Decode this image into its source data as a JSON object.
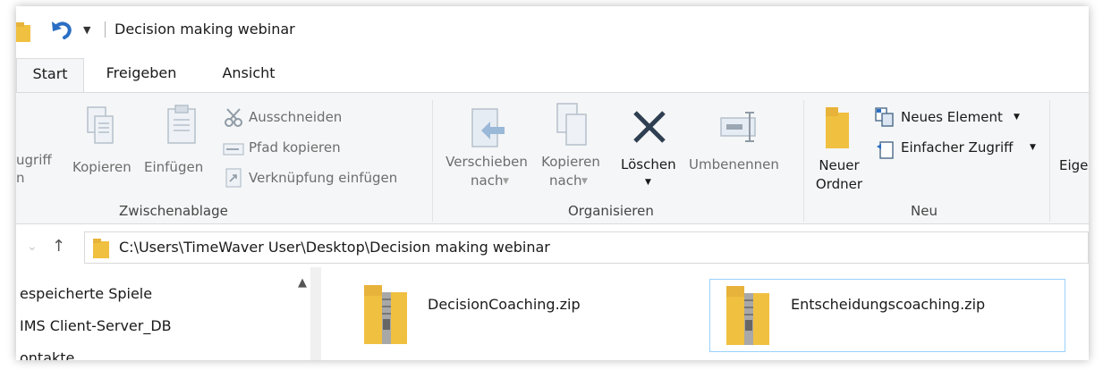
{
  "window": {
    "title": "Decision making webinar"
  },
  "quick_access": {
    "icons": [
      "folder-icon",
      "undo-icon",
      "customize-dropdown-icon"
    ]
  },
  "tabs": [
    {
      "label": "Start",
      "active": true
    },
    {
      "label": "Freigeben",
      "active": false
    },
    {
      "label": "Ansicht",
      "active": false
    }
  ],
  "ribbon": {
    "zwischenablage": {
      "label": "Zwischenablage",
      "access_clip_l1": "ugriff",
      "access_clip_l2": "n",
      "kopieren": "Kopieren",
      "einfuegen": "Einfügen",
      "ausschneiden": "Ausschneiden",
      "pfad_kopieren": "Pfad kopieren",
      "verknuepfung": "Verknüpfung einfügen"
    },
    "organisieren": {
      "label": "Organisieren",
      "verschieben_l1": "Verschieben",
      "verschieben_l2": "nach",
      "kopieren_l1": "Kopieren",
      "kopieren_l2": "nach",
      "loeschen": "Löschen",
      "umbenennen": "Umbenennen"
    },
    "neu": {
      "label": "Neu",
      "ordner_l1": "Neuer",
      "ordner_l2": "Ordner",
      "neues_element": "Neues Element",
      "einfacher_zugriff": "Einfacher Zugriff"
    },
    "clipped_next": "Eige"
  },
  "address": {
    "path": "C:\\Users\\TimeWaver User\\Desktop\\Decision making webinar"
  },
  "nav_pane": {
    "items": [
      {
        "label": "espeicherte Spiele"
      },
      {
        "label": "IMS Client-Server_DB"
      },
      {
        "label": "ontakte"
      }
    ]
  },
  "files": [
    {
      "name": "DecisionCoaching.zip",
      "selected": false
    },
    {
      "name": "Entscheidungscoaching.zip",
      "selected": true
    }
  ],
  "colors": {
    "folder": "#f0c040",
    "blue_accent": "#2b6fc4",
    "selection_border": "#99d1ff"
  }
}
